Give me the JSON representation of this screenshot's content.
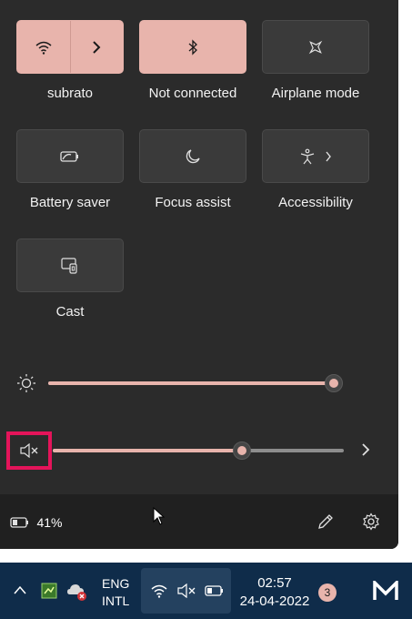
{
  "tiles": {
    "wifi": {
      "label": "subrato",
      "icon": "wifi-icon",
      "active": true
    },
    "bluetooth": {
      "label": "Not connected",
      "icon": "bluetooth-icon",
      "active": true
    },
    "airplane": {
      "label": "Airplane mode",
      "icon": "airplane-icon",
      "active": false
    },
    "battery_saver": {
      "label": "Battery saver",
      "icon": "battery-saver-icon",
      "active": false
    },
    "focus_assist": {
      "label": "Focus assist",
      "icon": "moon-icon",
      "active": false
    },
    "accessibility": {
      "label": "Accessibility",
      "icon": "accessibility-icon",
      "active": false
    },
    "cast": {
      "label": "Cast",
      "icon": "cast-icon",
      "active": false
    }
  },
  "sliders": {
    "brightness": {
      "icon": "sun-icon",
      "level": 1.0
    },
    "volume": {
      "icon": "speaker-muted-icon",
      "level": 0.65,
      "muted": true
    }
  },
  "footer": {
    "battery_percent": "41%",
    "edit_icon": "pencil-icon",
    "settings_icon": "gear-icon"
  },
  "taskbar": {
    "language_line1": "ENG",
    "language_line2": "INTL",
    "time": "02:57",
    "date": "24-04-2022",
    "notification_count": "3",
    "icons": [
      "chevron-up-icon",
      "app-icon",
      "cloud-error-icon",
      "wifi-icon",
      "speaker-muted-icon",
      "battery-icon",
      "logo-icon"
    ]
  },
  "colors": {
    "accent": "#e8b4ac",
    "panel": "#2b2b2b",
    "taskbar": "#0f2c4a",
    "highlight_box": "#e4145a"
  }
}
